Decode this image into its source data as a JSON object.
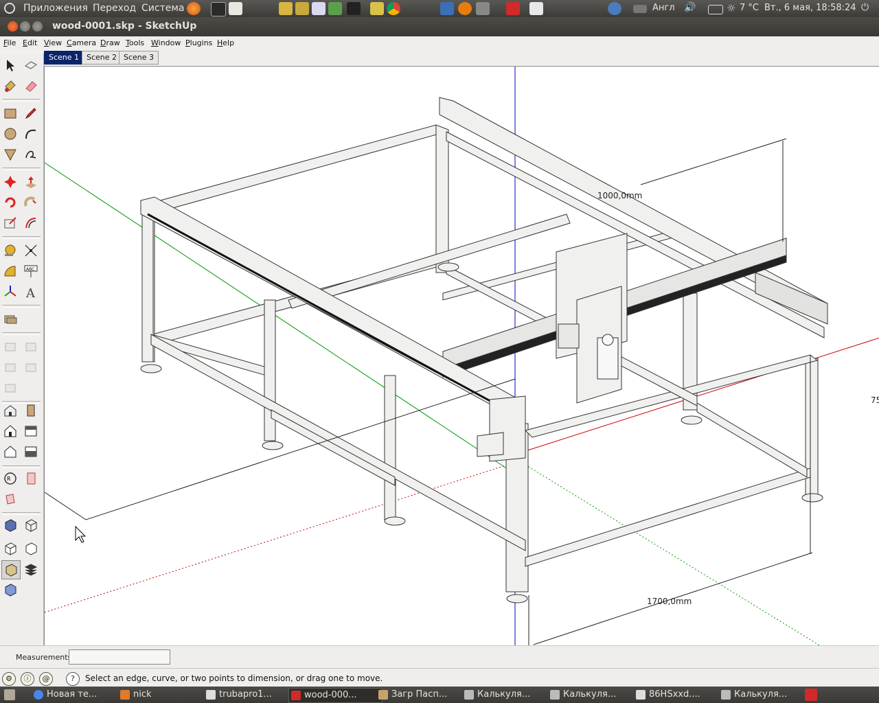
{
  "top_panel": {
    "menu": [
      "Приложения",
      "Переход",
      "Система"
    ],
    "keyboard_layout": "Англ",
    "weather": "7 °C",
    "clock": "Вт., 6 мая, 18:58:24"
  },
  "window": {
    "title": "wood-0001.skp - SketchUp"
  },
  "menubar": [
    "File",
    "Edit",
    "View",
    "Camera",
    "Draw",
    "Tools",
    "Window",
    "Plugins",
    "Help"
  ],
  "scene_tabs": [
    {
      "label": "Scene 1",
      "active": true
    },
    {
      "label": "Scene 2",
      "active": false
    },
    {
      "label": "Scene 3",
      "active": false
    }
  ],
  "viewport": {
    "dimensions": [
      "1000,0mm",
      "1700,0mm",
      "75"
    ],
    "axis_colors": {
      "red": "#cc0000",
      "green": "#009900",
      "blue": "#0000cc"
    }
  },
  "measurements": {
    "label": "Measurements",
    "value": ""
  },
  "status": {
    "text": "Select an edge, curve, or two points to dimension, or drag one to move."
  },
  "taskbar": [
    {
      "label": "Новая те...",
      "icon": "chrome-icon"
    },
    {
      "label": "nick",
      "icon": "folder-icon"
    },
    {
      "label": "trubapro1...",
      "icon": "document-icon"
    },
    {
      "label": "wood-000...",
      "icon": "sketchup-icon",
      "active": true
    },
    {
      "label": "Загр Пасп...",
      "icon": "folder-icon"
    },
    {
      "label": "Калькуля...",
      "icon": "calculator-icon"
    },
    {
      "label": "Калькуля...",
      "icon": "calculator-icon"
    },
    {
      "label": "86HSxxd....",
      "icon": "document-icon"
    },
    {
      "label": "Калькуля...",
      "icon": "calculator-icon"
    }
  ]
}
